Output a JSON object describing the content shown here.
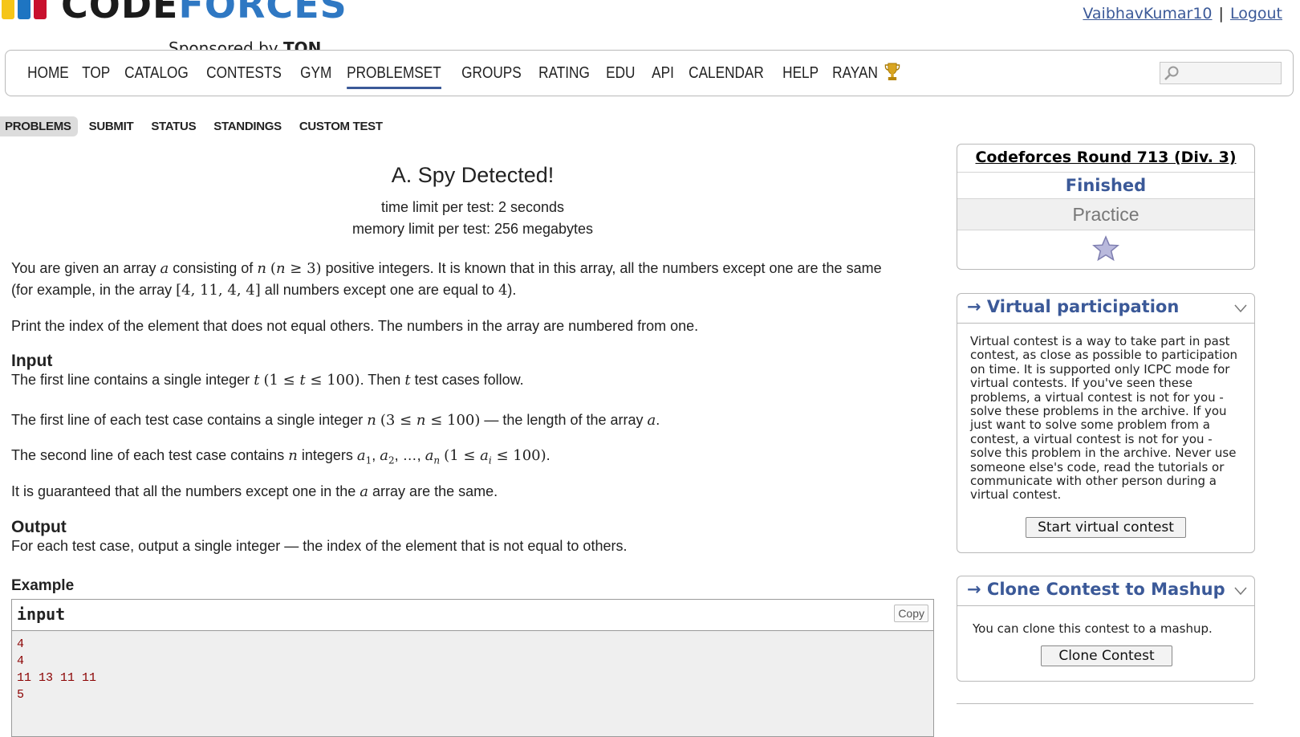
{
  "brand": {
    "logo_text_part1": "CODE",
    "logo_text_part2": "FORCES",
    "sponsor_prefix": "Sponsored by",
    "sponsor_name": "TON",
    "colors": {
      "yellow": "#f5c518",
      "blue": "#1e75c2",
      "red": "#c8102e",
      "link": "#3b5998"
    }
  },
  "user": {
    "username": "VaibhavKumar10",
    "separator": "|",
    "logout": "Logout"
  },
  "main_menu": {
    "items": [
      "HOME",
      "TOP",
      "CATALOG",
      "CONTESTS",
      "GYM",
      "PROBLEMSET",
      "GROUPS",
      "RATING",
      "EDU",
      "API",
      "CALENDAR",
      "HELP",
      "RAYAN"
    ],
    "active": "PROBLEMSET",
    "search_placeholder": ""
  },
  "sub_menu": {
    "items": [
      "PROBLEMS",
      "SUBMIT",
      "STATUS",
      "STANDINGS",
      "CUSTOM TEST"
    ],
    "active": "PROBLEMS"
  },
  "problem": {
    "title": "A. Spy Detected!",
    "time_limit": "time limit per test: 2 seconds",
    "memory_limit": "memory limit per test: 256 megabytes",
    "legend_1": "You are given an array",
    "legend_2": "consisting of",
    "legend_3": "positive integers. It is known that in this array, all the numbers except one are the same",
    "legend_4": "(for example, in the array",
    "legend_5": "all numbers except one are equal to",
    "legend_6": "Print the index of the element that does not equal others. The numbers in the array are numbered from one.",
    "input_title": "Input",
    "input_1a": "The first line contains a single integer",
    "input_1b": "Then",
    "input_1c": "test cases follow.",
    "input_2a": "The first line of each test case contains a single integer",
    "input_2b": "— the length of the array",
    "input_3a": "The second line of each test case contains",
    "input_3b": "integers",
    "input_4a": "It is guaranteed that all the numbers except one in the",
    "input_4b": "array are the same.",
    "output_title": "Output",
    "output_text": "For each test case, output a single integer — the index of the element that is not equal to others.",
    "example_title": "Example",
    "sample_input_label": "input",
    "copy_label": "Copy",
    "sample_lines": [
      "4",
      "4",
      "11 13 11 11",
      "5"
    ]
  },
  "sidebar": {
    "round_name": "Codeforces Round 713 (Div. 3)",
    "round_status": "Finished",
    "practice": "Practice",
    "virtual_caption": "→ Virtual participation",
    "virtual_text": "Virtual contest is a way to take part in past contest, as close as possible to participation on time. It is supported only ICPC mode for virtual contests. If you've seen these problems, a virtual contest is not for you - solve these problems in the archive. If you just want to solve some problem from a contest, a virtual contest is not for you - solve this problem in the archive. Never use someone else's code, read the tutorials or communicate with other person during a virtual contest.",
    "virtual_button": "Start virtual contest",
    "clone_caption": "→ Clone Contest to Mashup",
    "clone_text": "You can clone this contest to a mashup.",
    "clone_button": "Clone Contest"
  }
}
